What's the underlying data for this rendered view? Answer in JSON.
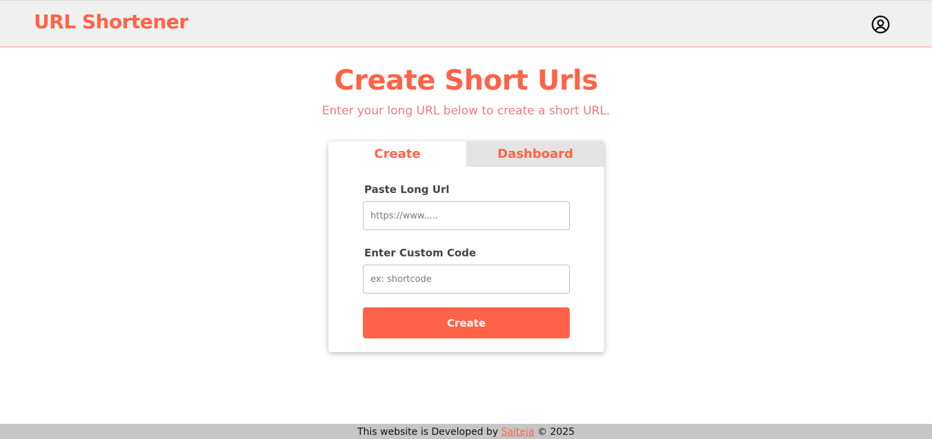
{
  "header": {
    "brand": "URL Shortener",
    "profile_icon": "user-circle-icon"
  },
  "hero": {
    "title": "Create Short Urls",
    "subtitle": "Enter your long URL below to create a short URL."
  },
  "card": {
    "tabs": [
      {
        "label": "Create",
        "active": true
      },
      {
        "label": "Dashboard",
        "active": false
      }
    ],
    "form": {
      "long_url_label": "Paste Long Url",
      "long_url_placeholder": "https://www.....",
      "long_url_value": "",
      "custom_code_label": "Enter Custom Code",
      "custom_code_placeholder": "ex: shortcode",
      "custom_code_value": "",
      "submit_label": "Create"
    }
  },
  "footer": {
    "prefix": "This website is Developed by ",
    "author": "Saiteja",
    "suffix": " © 2025"
  },
  "colors": {
    "accent": "#ff6347",
    "header_bg": "#f0f0f0",
    "inactive_tab_bg": "#e4e4e4",
    "footer_bg": "#c6c6c6"
  }
}
